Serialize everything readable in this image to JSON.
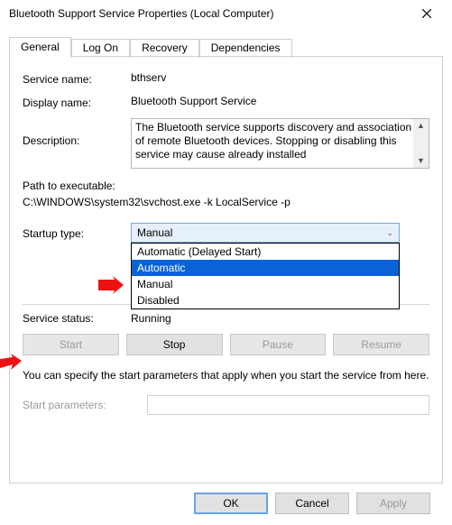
{
  "window": {
    "title": "Bluetooth Support Service Properties (Local Computer)"
  },
  "tabs": {
    "items": [
      {
        "label": "General"
      },
      {
        "label": "Log On"
      },
      {
        "label": "Recovery"
      },
      {
        "label": "Dependencies"
      }
    ]
  },
  "general": {
    "service_name_label": "Service name:",
    "service_name_value": "bthserv",
    "display_name_label": "Display name:",
    "display_name_value": "Bluetooth Support Service",
    "description_label": "Description:",
    "description_value": "The Bluetooth service supports discovery and association of remote Bluetooth devices.  Stopping or disabling this service may cause already installed",
    "path_label": "Path to executable:",
    "path_value": "C:\\WINDOWS\\system32\\svchost.exe -k LocalService -p",
    "startup_type_label": "Startup type:",
    "startup_type_value": "Manual",
    "startup_options": {
      "o0": "Automatic (Delayed Start)",
      "o1": "Automatic",
      "o2": "Manual",
      "o3": "Disabled"
    },
    "service_status_label": "Service status:",
    "service_status_value": "Running",
    "buttons": {
      "start": "Start",
      "stop": "Stop",
      "pause": "Pause",
      "resume": "Resume"
    },
    "info_text": "You can specify the start parameters that apply when you start the service from here.",
    "start_params_label": "Start parameters:",
    "start_params_value": ""
  },
  "footer": {
    "ok": "OK",
    "cancel": "Cancel",
    "apply": "Apply"
  }
}
